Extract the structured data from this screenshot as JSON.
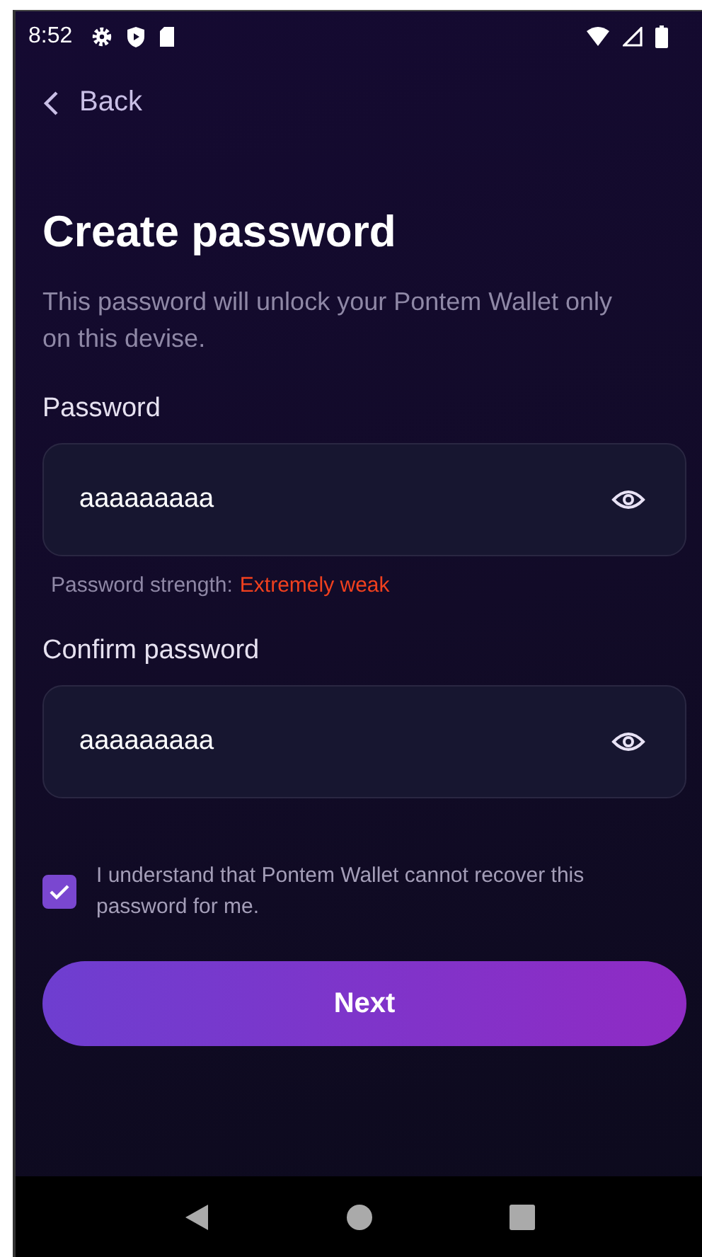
{
  "status_bar": {
    "time": "8:52"
  },
  "back": {
    "label": "Back"
  },
  "title": "Create password",
  "subtitle": "This password will unlock your Pontem Wallet only on this devise.",
  "fields": [
    {
      "label": "Password",
      "value": "aaaaaaaaa",
      "strength": {
        "label": "Password strength:",
        "value": "Extremely weak",
        "color": "#f0401e"
      }
    },
    {
      "label": "Confirm password",
      "value": "aaaaaaaaa"
    }
  ],
  "agreement": {
    "checked": true,
    "text": "I understand that Pontem Wallet cannot recover this password for me."
  },
  "next_button": {
    "label": "Next"
  }
}
